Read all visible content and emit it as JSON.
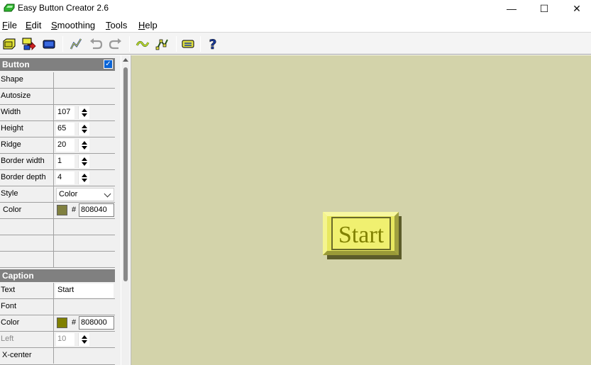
{
  "window": {
    "title": "Easy Button Creator 2.6",
    "minimize_glyph": "—",
    "maximize_glyph": "☐",
    "close_glyph": "✕"
  },
  "menu": [
    {
      "pre": "",
      "ul": "F",
      "post": "ile"
    },
    {
      "pre": "",
      "ul": "E",
      "post": "dit"
    },
    {
      "pre": "",
      "ul": "S",
      "post": "moothing"
    },
    {
      "pre": "",
      "ul": "T",
      "post": "ools"
    },
    {
      "pre": "",
      "ul": "H",
      "post": "elp"
    }
  ],
  "toolbar": {
    "icons": [
      "new-button-icon",
      "export-icon",
      "button-shape-icon",
      "draw-icon",
      "undo-icon",
      "redo-icon",
      "smoothing-icon",
      "edit-points-icon",
      "layout-icon",
      "help-icon"
    ],
    "help_glyph": "?"
  },
  "button_section": {
    "title": "Button",
    "checkbox_glyph": "✓",
    "shape_label": "Shape",
    "autosize_label": "Autosize",
    "width_label": "Width",
    "width_value": "107",
    "height_label": "Height",
    "height_value": "65",
    "ridge_label": "Ridge",
    "ridge_value": "20",
    "border_width_label": "Border width",
    "border_width_value": "1",
    "border_depth_label": "Border depth",
    "border_depth_value": "4",
    "style_label": "Style",
    "style_value": "Color",
    "color_label": "Color",
    "color_hash": "#",
    "color_value": "808040"
  },
  "caption_section": {
    "title": "Caption",
    "text_label": "Text",
    "text_value": "Start",
    "font_label": "Font",
    "color_label": "Color",
    "color_hash": "#",
    "color_value": "808000",
    "left_label": "Left",
    "left_value": "10",
    "xcenter_label": "X-center"
  },
  "preview": {
    "caption": "Start"
  },
  "colors": {
    "button_color": "#808040",
    "caption_color": "#808000",
    "canvas_bg": "#d3d3aa",
    "button_face": "#f0f070",
    "header_bg": "#808080",
    "accent": "#0a64d6"
  }
}
